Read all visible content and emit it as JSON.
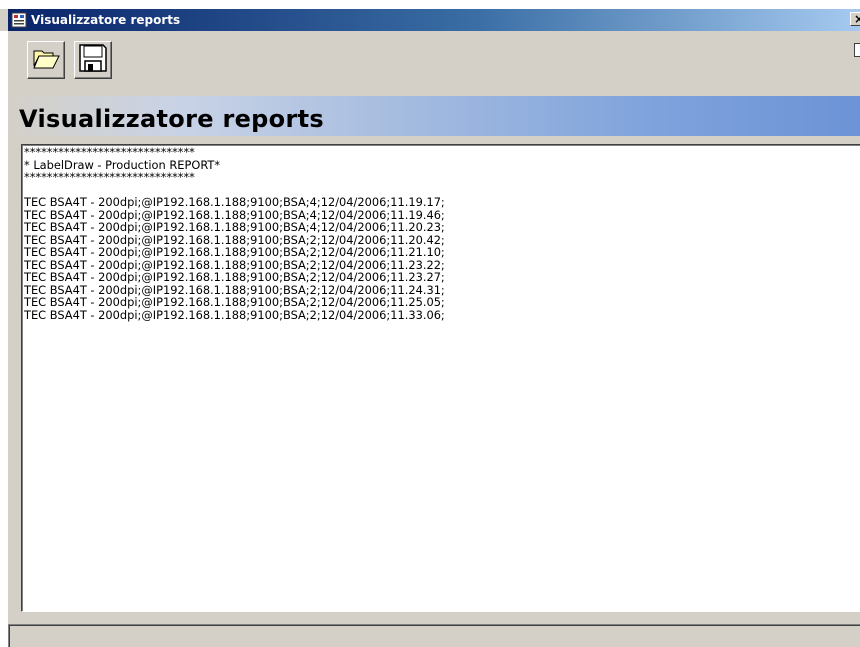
{
  "window": {
    "title": "Visualizzatore reports",
    "close_glyph": "×"
  },
  "toolbar": {
    "open_icon": "folder-open-icon",
    "save_icon": "floppy-disk-icon"
  },
  "banner": {
    "title": "Visualizzatore reports"
  },
  "report": {
    "lines": [
      "******************************",
      "* LabelDraw - Production REPORT*",
      "******************************",
      "",
      "TEC BSA4T - 200dpi;@IP192.168.1.188;9100;BSA;4;12/04/2006;11.19.17;",
      "TEC BSA4T - 200dpi;@IP192.168.1.188;9100;BSA;4;12/04/2006;11.19.46;",
      "TEC BSA4T - 200dpi;@IP192.168.1.188;9100;BSA;4;12/04/2006;11.20.23;",
      "TEC BSA4T - 200dpi;@IP192.168.1.188;9100;BSA;2;12/04/2006;11.20.42;",
      "TEC BSA4T - 200dpi;@IP192.168.1.188;9100;BSA;2;12/04/2006;11.21.10;",
      "TEC BSA4T - 200dpi;@IP192.168.1.188;9100;BSA;2;12/04/2006;11.23.22;",
      "TEC BSA4T - 200dpi;@IP192.168.1.188;9100;BSA;2;12/04/2006;11.23.27;",
      "TEC BSA4T - 200dpi;@IP192.168.1.188;9100;BSA;2;12/04/2006;11.24.31;",
      "TEC BSA4T - 200dpi;@IP192.168.1.188;9100;BSA;2;12/04/2006;11.25.05;",
      "TEC BSA4T - 200dpi;@IP192.168.1.188;9100;BSA;2;12/04/2006;11.33.06;"
    ]
  },
  "status": {
    "text": ""
  }
}
